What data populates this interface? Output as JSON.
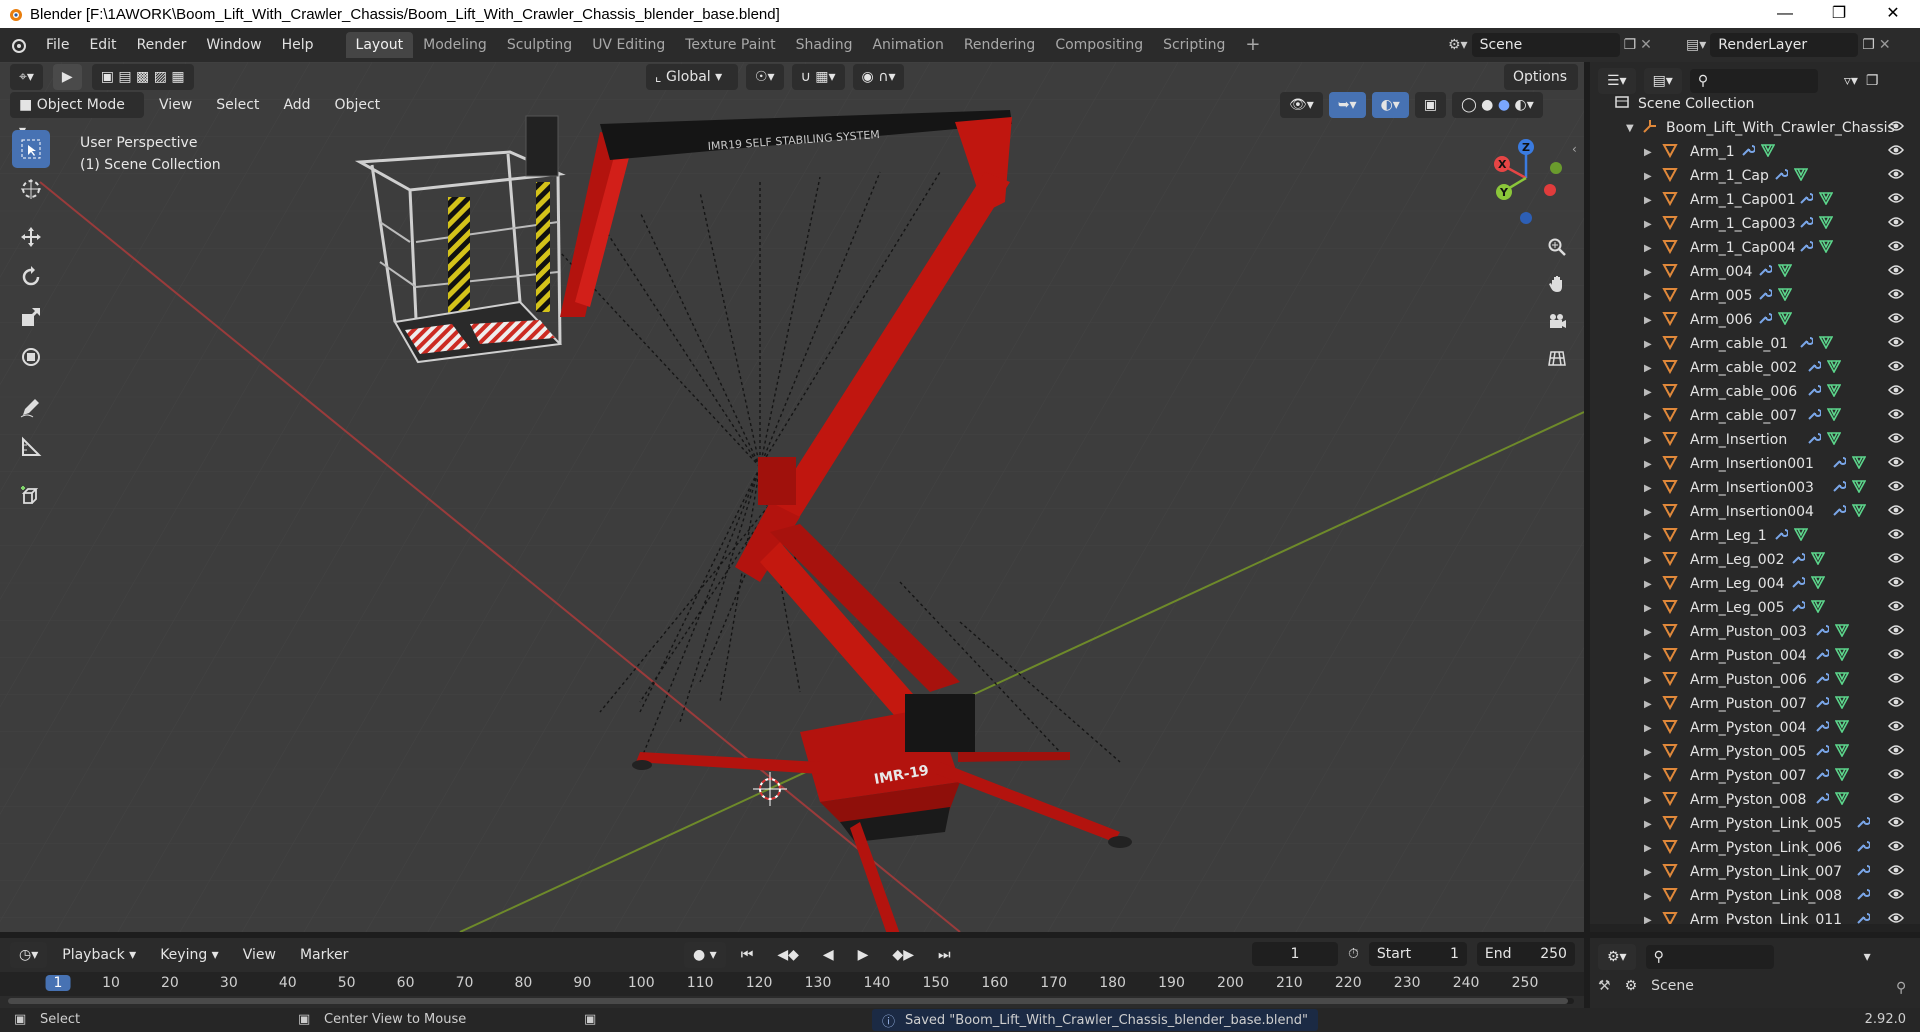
{
  "window": {
    "title": "Blender [F:\\1AWORK\\Boom_Lift_With_Crawler_Chassis/Boom_Lift_With_Crawler_Chassis_blender_base.blend]"
  },
  "menu": [
    "File",
    "Edit",
    "Render",
    "Window",
    "Help"
  ],
  "workspaces": [
    "Layout",
    "Modeling",
    "Sculpting",
    "UV Editing",
    "Texture Paint",
    "Shading",
    "Animation",
    "Rendering",
    "Compositing",
    "Scripting"
  ],
  "active_workspace": "Layout",
  "scene": {
    "name": "Scene",
    "render_layer": "RenderLayer"
  },
  "viewport": {
    "transform_orientation": "Global",
    "options_label": "Options",
    "mode": "Object Mode",
    "header_menus": [
      "View",
      "Select",
      "Add",
      "Object"
    ],
    "overlay_line1": "User Perspective",
    "overlay_line2": "(1) Scene Collection",
    "model_label_boom": "IMR19 SELF STABILING SYSTEM",
    "model_label_base": "IMR-19"
  },
  "outliner": {
    "root": "Scene Collection",
    "collection": "Boom_Lift_With_Crawler_Chassis",
    "items": [
      "Arm_1",
      "Arm_1_Cap",
      "Arm_1_Cap001",
      "Arm_1_Cap003",
      "Arm_1_Cap004",
      "Arm_004",
      "Arm_005",
      "Arm_006",
      "Arm_cable_01",
      "Arm_cable_002",
      "Arm_cable_006",
      "Arm_cable_007",
      "Arm_Insertion",
      "Arm_Insertion001",
      "Arm_Insertion003",
      "Arm_Insertion004",
      "Arm_Leg_1",
      "Arm_Leg_002",
      "Arm_Leg_004",
      "Arm_Leg_005",
      "Arm_Puston_003",
      "Arm_Puston_004",
      "Arm_Puston_006",
      "Arm_Puston_007",
      "Arm_Pyston_004",
      "Arm_Pyston_005",
      "Arm_Pyston_007",
      "Arm_Pyston_008",
      "Arm_Pyston_Link_005",
      "Arm_Pyston_Link_006",
      "Arm_Pyston_Link_007",
      "Arm_Pyston_Link_008",
      "Arm_Pyston_Link_011"
    ]
  },
  "timeline": {
    "menus": [
      "Playback",
      "Keying",
      "View",
      "Marker"
    ],
    "current_frame": "1",
    "start_label": "Start",
    "start": "1",
    "end_label": "End",
    "end": "250",
    "ruler": [
      "1",
      "10",
      "20",
      "30",
      "40",
      "50",
      "60",
      "70",
      "80",
      "90",
      "100",
      "110",
      "120",
      "130",
      "140",
      "150",
      "160",
      "170",
      "180",
      "190",
      "200",
      "210",
      "220",
      "230",
      "240",
      "250"
    ]
  },
  "properties": {
    "scene_label": "Scene"
  },
  "status": {
    "left": "Select",
    "middle": "Center View to Mouse",
    "message": "Saved \"Boom_Lift_With_Crawler_Chassis_blender_base.blend\"",
    "version": "2.92.0"
  },
  "colors": {
    "accent": "#4772b3",
    "model_red": "#b3130e",
    "grid_red": "#9a3b3b",
    "grid_green": "#6e8a2a"
  }
}
